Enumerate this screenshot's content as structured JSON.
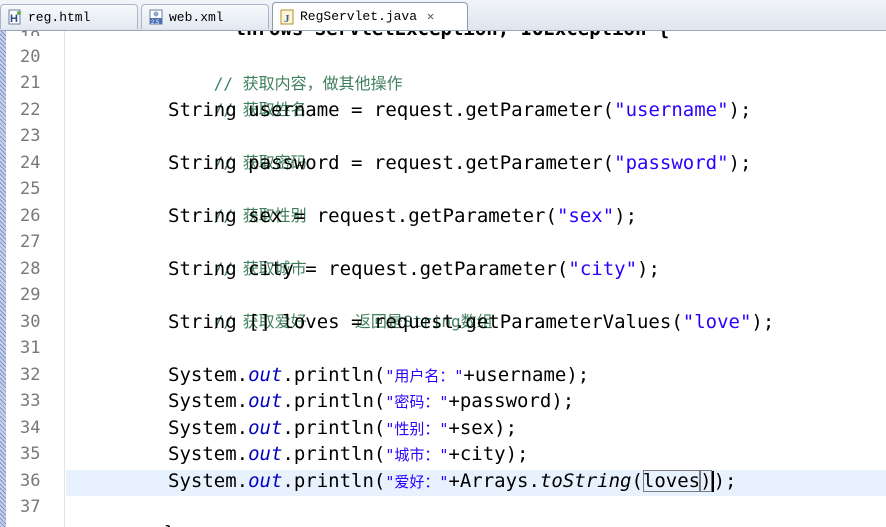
{
  "tabs": [
    {
      "label": "reg.html",
      "icon": "html-file-icon",
      "active": false
    },
    {
      "label": "web.xml",
      "icon": "xml-file-icon",
      "active": false
    },
    {
      "label": "RegServlet.java",
      "icon": "java-file-icon",
      "active": true,
      "close": "✕"
    }
  ],
  "editor": {
    "partial_top": "      throws ServletException, IOException {",
    "lines": [
      {
        "n": "20",
        "comment": "// 获取内容，做其他操作"
      },
      {
        "n": "21",
        "comment": "// 获取姓名"
      },
      {
        "n": "22",
        "code_a": "String username = request.getParameter(",
        "str": "\"username\"",
        "code_b": ");"
      },
      {
        "n": "23",
        "comment": "// 获取密码"
      },
      {
        "n": "24",
        "code_a": "String password = request.getParameter(",
        "str": "\"password\"",
        "code_b": ");"
      },
      {
        "n": "25",
        "comment": "// 获取性别"
      },
      {
        "n": "26",
        "code_a": "String sex = request.getParameter(",
        "str": "\"sex\"",
        "code_b": ");"
      },
      {
        "n": "27",
        "comment": "// 获取城市"
      },
      {
        "n": "28",
        "code_a": "String city = request.getParameter(",
        "str": "\"city\"",
        "code_b": ");"
      },
      {
        "n": "29",
        "comment": "// 获取爱好     返回是String数组"
      },
      {
        "n": "30",
        "code_a": "String [] loves = request.getParameterValues(",
        "str": "\"love\"",
        "code_b": ");"
      },
      {
        "n": "31"
      },
      {
        "n": "32",
        "sys": "System.",
        "out": "out",
        "println": ".println(",
        "str": "\"用户名：\"",
        "rest": "+username);"
      },
      {
        "n": "33",
        "sys": "System.",
        "out": "out",
        "println": ".println(",
        "str": "\"密码：\"",
        "rest": "+password);"
      },
      {
        "n": "34",
        "sys": "System.",
        "out": "out",
        "println": ".println(",
        "str": "\"性别：\"",
        "rest": "+sex);"
      },
      {
        "n": "35",
        "sys": "System.",
        "out": "out",
        "println": ".println(",
        "str": "\"城市：\"",
        "rest": "+city);"
      },
      {
        "n": "36",
        "sys": "System.",
        "out": "out",
        "println": ".println(",
        "str": "\"爱好：\"",
        "rest_a": "+Arrays.",
        "to_string": "toString",
        "paren": "(",
        "arg": "loves",
        "rest_b": ")",
        "rest_c": ");"
      },
      {
        "n": "37",
        "brace": "}"
      }
    ]
  }
}
